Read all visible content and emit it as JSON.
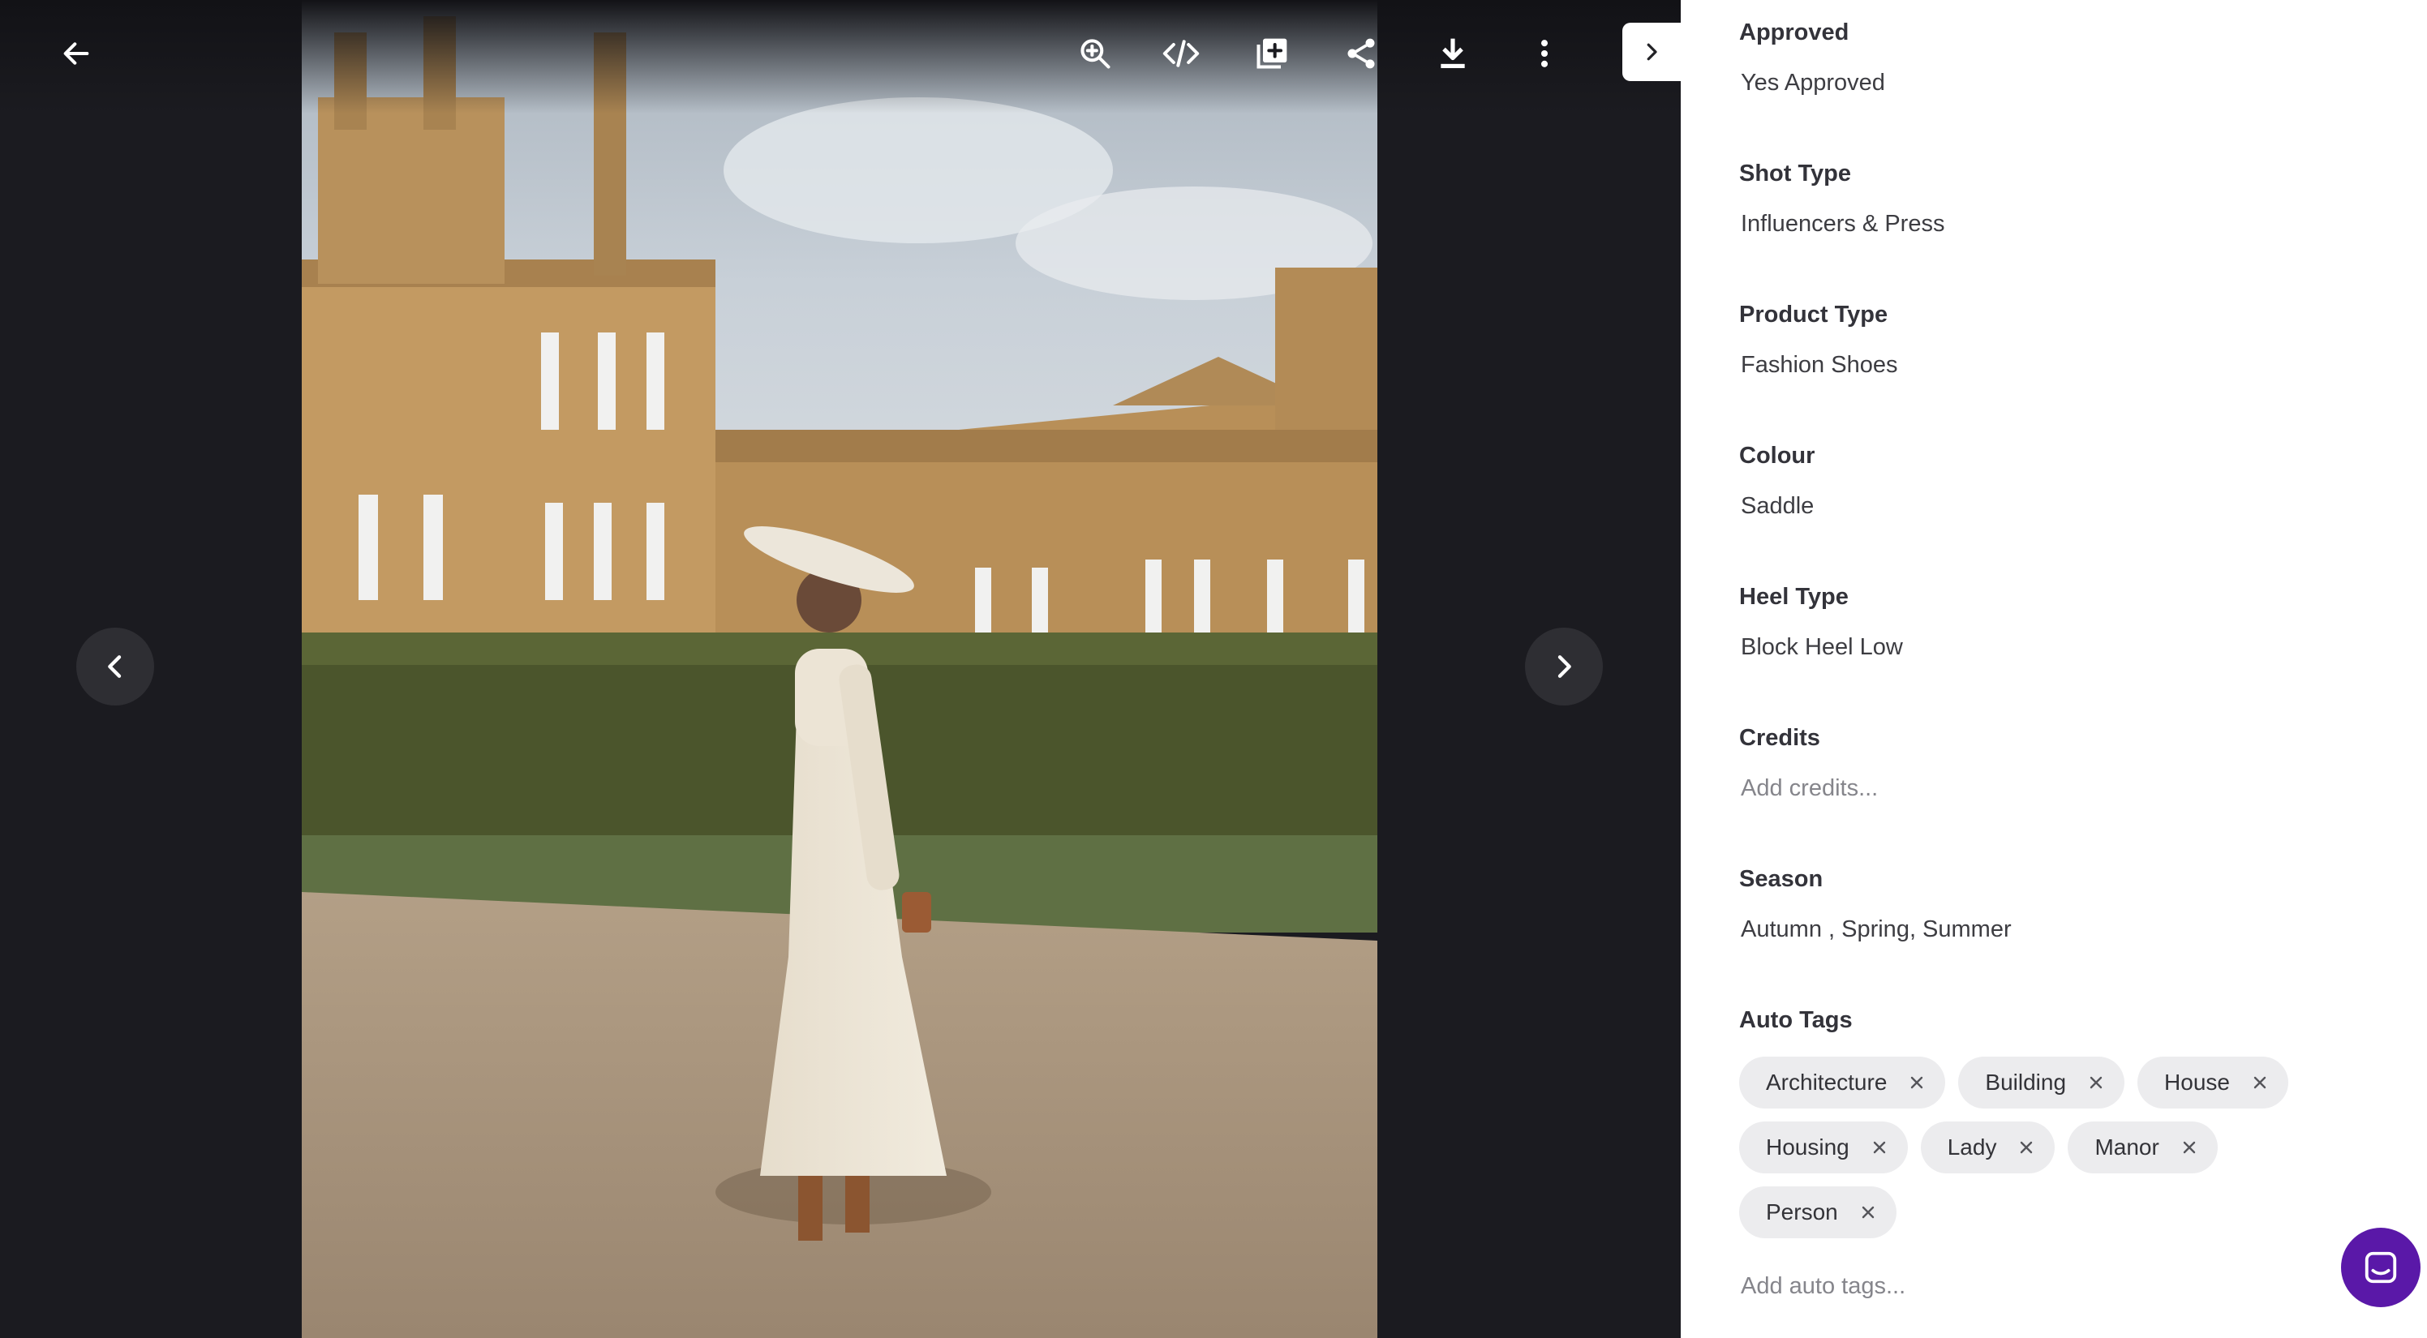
{
  "viewer": {
    "photo_alt": "",
    "toolbar": {
      "icons": [
        "zoom-in-icon",
        "embed-code-icon",
        "add-to-collection-icon",
        "share-icon",
        "download-icon",
        "more-vertical-icon"
      ]
    },
    "nav": {
      "prev_icon": "chevron-left-icon",
      "next_icon": "chevron-right-icon"
    },
    "back_icon": "arrow-left-icon",
    "collapse_icon": "chevron-right-icon"
  },
  "details": {
    "fields": [
      {
        "label": "Approved",
        "value": "Yes Approved"
      },
      {
        "label": "Shot Type",
        "value": "Influencers & Press"
      },
      {
        "label": "Product Type",
        "value": "Fashion Shoes"
      },
      {
        "label": "Colour",
        "value": "Saddle"
      },
      {
        "label": "Heel Type",
        "value": "Block Heel Low"
      },
      {
        "label": "Credits",
        "placeholder": "Add credits..."
      },
      {
        "label": "Season",
        "value": "Autumn , Spring, Summer"
      }
    ],
    "auto_tags": {
      "label": "Auto Tags",
      "tags": [
        "Architecture",
        "Building",
        "House",
        "Housing",
        "Lady",
        "Manor",
        "Person"
      ],
      "placeholder": "Add auto tags..."
    }
  },
  "colors": {
    "viewer_bg": "#1b1b20",
    "panel_bg": "#ffffff",
    "tag_bg": "#ececee",
    "chat_launcher": "#5a18a8"
  }
}
